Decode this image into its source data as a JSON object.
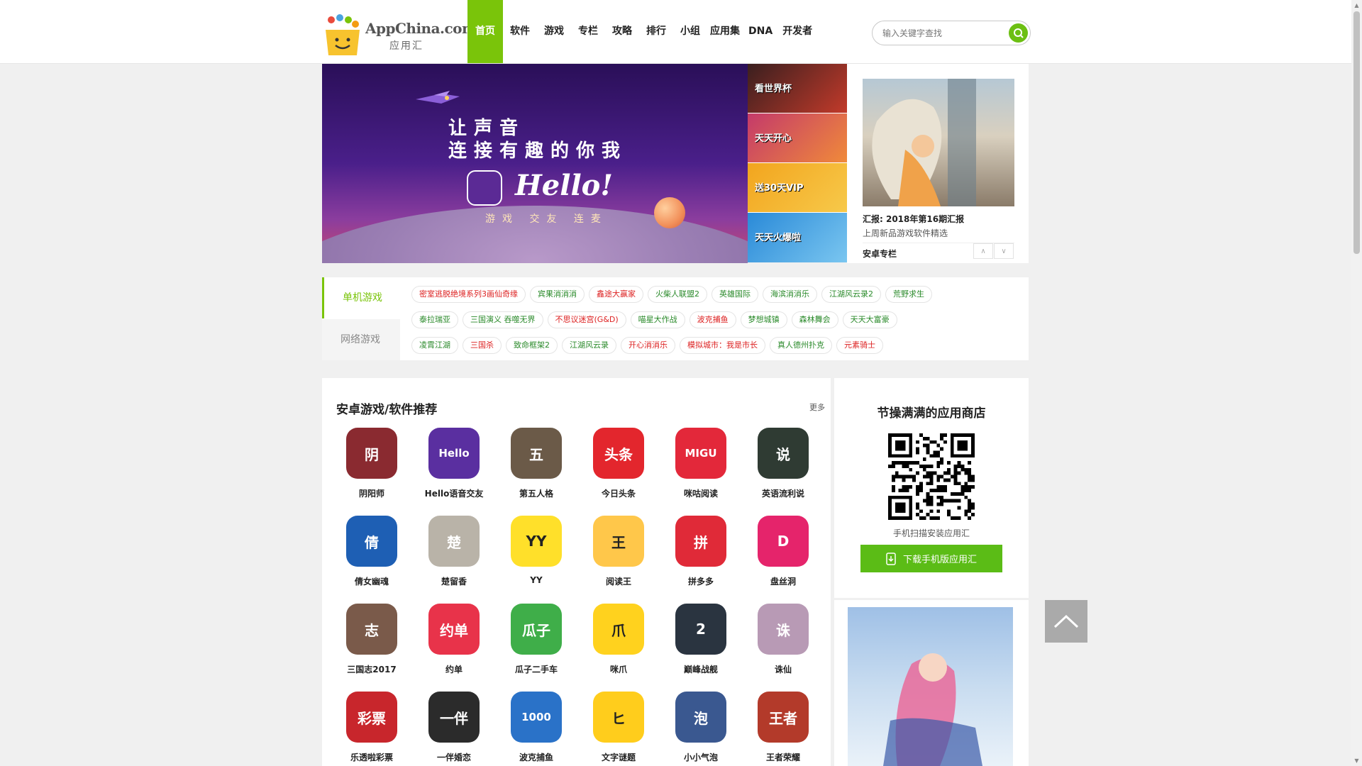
{
  "header": {
    "logo_text": "AppChina.com",
    "logo_cn": "应用汇",
    "nav": [
      "首页",
      "软件",
      "游戏",
      "专栏",
      "攻略",
      "排行",
      "小组",
      "应用集",
      "DNA",
      "开发者"
    ],
    "search_placeholder": "输入关键字查找"
  },
  "banner": {
    "line1": "让声音",
    "line2": "连接有趣的你我",
    "hello": "Hello!",
    "sub": "游戏 交友 连麦",
    "thumbs": [
      "看世界杯",
      "天天开心",
      "送30天VIP",
      "天天火爆啦"
    ]
  },
  "feature": {
    "title": "汇报: 2018年第16期汇报",
    "desc": "上周新品游戏软件精选",
    "tag": "安卓专栏"
  },
  "tags": {
    "tab_single": "单机游戏",
    "tab_online": "网络游戏",
    "row1": [
      "密室逃脱绝境系列3画仙奇缘",
      "宾果消消消",
      "鑫途大赢家",
      "火柴人联盟2",
      "英雄国际",
      "海滨消消乐",
      "江湖风云录2",
      "荒野求生"
    ],
    "row2": [
      "泰拉瑞亚",
      "三国演义 吞噬无界",
      "不思议迷宫(G&D)",
      "喵星大作战",
      "波克捕鱼",
      "梦想城镇",
      "森林舞会",
      "天天大富豪"
    ],
    "row3": [
      "凌霄江湖",
      "三国杀",
      "致命框架2",
      "江湖风云录",
      "开心消消乐",
      "模拟城市：我是市长",
      "真人德州扑克",
      "元素骑士"
    ],
    "colors": {
      "row1": [
        "#d22",
        "#2a8a2a",
        "#d22",
        "#2a8a2a",
        "#2a8a2a",
        "#2a8a2a",
        "#2a8a2a",
        "#2a8a2a"
      ],
      "row2": [
        "#2a8a2a",
        "#2a8a2a",
        "#d22",
        "#2a8a2a",
        "#d22",
        "#2a8a2a",
        "#2a8a2a",
        "#2a8a2a"
      ],
      "row3": [
        "#2a8a2a",
        "#d22",
        "#2a8a2a",
        "#2a8a2a",
        "#d22",
        "#d22",
        "#2a8a2a",
        "#d22"
      ]
    }
  },
  "recommend": {
    "title": "安卓游戏/软件推荐",
    "more": "更多",
    "apps": [
      {
        "name": "阴阳师",
        "glyph": "阴",
        "bg": "#8a2a30"
      },
      {
        "name": "Hello语音交友",
        "glyph": "Hello",
        "bg": "#5a2fa0"
      },
      {
        "name": "第五人格",
        "glyph": "五",
        "bg": "#6b5a48"
      },
      {
        "name": "今日头条",
        "glyph": "头条",
        "bg": "#e3262d"
      },
      {
        "name": "咪咕阅读",
        "glyph": "MIGU",
        "bg": "#e3283a"
      },
      {
        "name": "英语流利说",
        "glyph": "说",
        "bg": "#2f3b33"
      },
      {
        "name": "倩女幽魂",
        "glyph": "倩",
        "bg": "#1e5fb4"
      },
      {
        "name": "楚留香",
        "glyph": "楚",
        "bg": "#b9b3a8"
      },
      {
        "name": "YY",
        "glyph": "YY",
        "bg": "#ffe02a"
      },
      {
        "name": "阅读王",
        "glyph": "王",
        "bg": "#ffc74a"
      },
      {
        "name": "拼多多",
        "glyph": "拼",
        "bg": "#e02a38"
      },
      {
        "name": "盘丝洞",
        "glyph": "D",
        "bg": "#e5246b"
      },
      {
        "name": "三国志2017",
        "glyph": "志",
        "bg": "#7a5a4a"
      },
      {
        "name": "约单",
        "glyph": "约单",
        "bg": "#e8334a"
      },
      {
        "name": "瓜子二手车",
        "glyph": "瓜子",
        "bg": "#3fae49"
      },
      {
        "name": "咪爪",
        "glyph": "爪",
        "bg": "#ffd21e"
      },
      {
        "name": "巅峰战舰",
        "glyph": "2",
        "bg": "#2a3440"
      },
      {
        "name": "诛仙",
        "glyph": "诛",
        "bg": "#b89ab5"
      },
      {
        "name": "乐透啦彩票",
        "glyph": "彩票",
        "bg": "#c8262c"
      },
      {
        "name": "一伴婚恋",
        "glyph": "一伴",
        "bg": "#2b2b2b"
      },
      {
        "name": "波克捕鱼",
        "glyph": "1000",
        "bg": "#2a72c8"
      },
      {
        "name": "文字谜题",
        "glyph": "ヒ",
        "bg": "#ffcd1c"
      },
      {
        "name": "小小气泡",
        "glyph": "泡",
        "bg": "#3a5890"
      },
      {
        "name": "王者荣耀",
        "glyph": "王者",
        "bg": "#b33a2a"
      }
    ]
  },
  "store": {
    "title": "节操满满的应用商店",
    "desc": "手机扫描安装应用汇",
    "download": "下载手机版应用汇"
  },
  "colors": {
    "accent": "#7ac40a",
    "button": "#5bbc16"
  }
}
